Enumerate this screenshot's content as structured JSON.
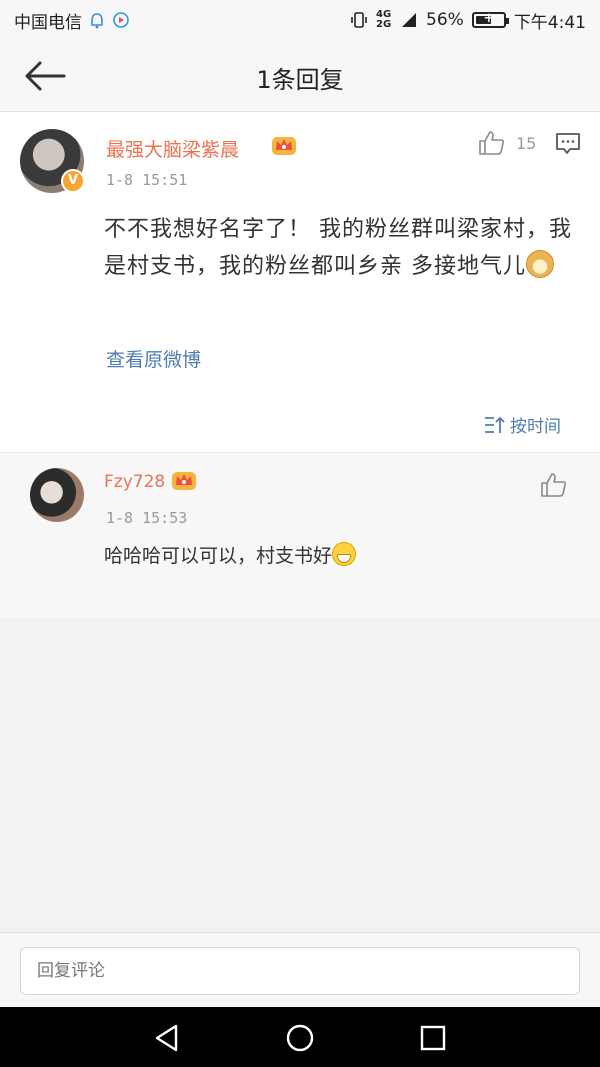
{
  "status_bar": {
    "carrier": "中国电信",
    "network": "4G 2G",
    "battery": "56%",
    "battery_level": 0.56,
    "time": "下午4:41"
  },
  "header": {
    "title": "1条回复"
  },
  "comment": {
    "username": "最强大脑梁紫晨",
    "verified": "V",
    "timestamp": "1-8 15:51",
    "like_count": "15",
    "text": "不不我想好名字了！ 我的粉丝群叫梁家村，我是村支书，我的粉丝都叫乡亲 多接地气儿",
    "view_original": "查看原微博",
    "sort_label": "按时间"
  },
  "reply": {
    "username": "Fzy728",
    "timestamp": "1-8 15:53",
    "text": "哈哈哈可以可以，村支书好"
  },
  "input": {
    "placeholder": "回复评论"
  },
  "colors": {
    "username": "#eb7350",
    "link": "#507daf",
    "verified": "#f7a531"
  }
}
